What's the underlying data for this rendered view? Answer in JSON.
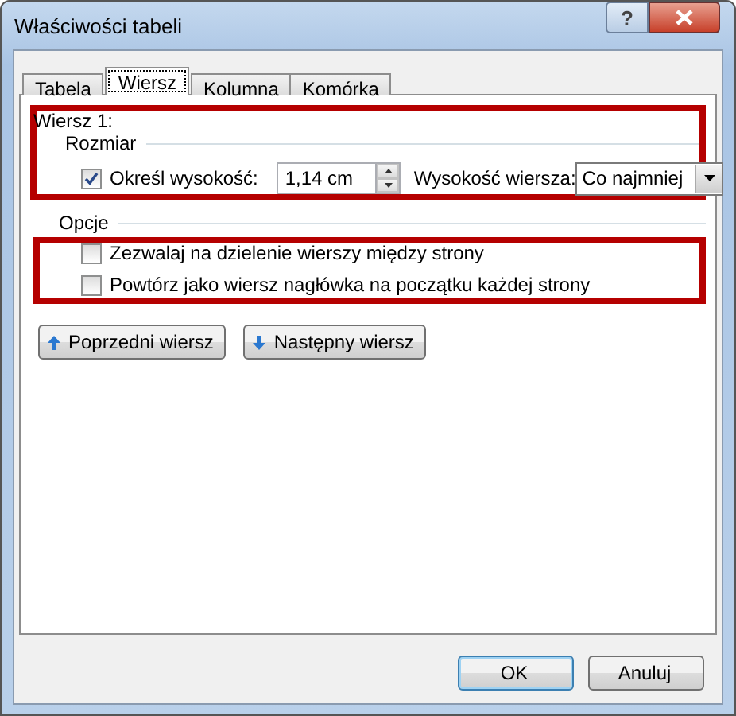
{
  "window": {
    "title": "Właściwości tabeli",
    "help": "?"
  },
  "tabs": [
    {
      "label": "Tabela",
      "selected": false
    },
    {
      "label": "Wiersz",
      "selected": true
    },
    {
      "label": "Kolumna",
      "selected": false
    },
    {
      "label": "Komórka",
      "selected": false
    }
  ],
  "row_section": {
    "heading": "Wiersz 1:",
    "size_heading": "Rozmiar",
    "specify_height": {
      "label": "Określ wysokość:",
      "checked": true
    },
    "height_field": {
      "value": "1,14 cm"
    },
    "row_height_label": "Wysokość wiersza:",
    "row_height_dropdown": {
      "value": "Co najmniej"
    }
  },
  "options": {
    "heading": "Opcje",
    "checkboxes": [
      {
        "label": "Zezwalaj na dzielenie wierszy między strony",
        "checked": false
      },
      {
        "label": "Powtórz jako wiersz nagłówka na początku każdej strony",
        "checked": false
      }
    ]
  },
  "nav_buttons": [
    {
      "label": "Poprzedni wiersz",
      "kind": "up"
    },
    {
      "label": "Następny wiersz",
      "kind": "down"
    }
  ],
  "dialog_buttons": [
    {
      "label": "OK",
      "default": true
    },
    {
      "label": "Anuluj",
      "default": false
    }
  ]
}
